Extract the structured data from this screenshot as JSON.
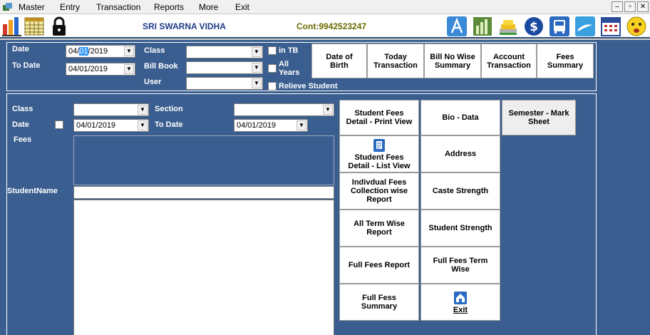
{
  "menu": {
    "items": [
      "Master",
      "Entry",
      "Transaction",
      "Reports",
      "More",
      "Exit"
    ]
  },
  "window_controls": {
    "minimize": "–",
    "restore": "▫",
    "close": "✕"
  },
  "header": {
    "school_name": "SRI SWARNA VIDHA",
    "contact": "Cont:9942523247"
  },
  "toolbar_icons": [
    "bar-chart-icon",
    "calendar-grid-icon",
    "lock-icon",
    "app-a-icon",
    "chart-report-icon",
    "cash-stack-icon",
    "dollar-icon",
    "bus-icon",
    "mail-icon",
    "calendar-icon",
    "smiley-icon"
  ],
  "top_filter": {
    "date_label": "Date",
    "date_value_pre": "04/",
    "date_value_sel": "01",
    "date_value_post": "/2019",
    "to_date_label": "To Date",
    "to_date_value": "04/01/2019",
    "class_label": "Class",
    "class_value": "",
    "bill_book_label": "Bill Book",
    "bill_book_value": "",
    "user_label": "User",
    "user_value": "",
    "in_tb_label": "in TB",
    "all_years_label_1": "All",
    "all_years_label_2": "Years",
    "relieve_label": "Relieve Student"
  },
  "top_buttons": [
    [
      "Date of",
      "Birth"
    ],
    [
      "Today",
      "Transaction"
    ],
    [
      "Bill No Wise",
      "Summary"
    ],
    [
      "Account",
      "Transaction"
    ],
    [
      "Fees",
      "Summary"
    ]
  ],
  "bottom_filter": {
    "class_label": "Class",
    "class_value": "",
    "section_label": "Section",
    "section_value": "",
    "date_label": "Date",
    "date_value": "04/01/2019",
    "to_date_label": "To Date",
    "to_date_value": "04/01/2019",
    "fees_label": "Fees",
    "student_name_label": "StudentName",
    "student_name_value": ""
  },
  "report_buttons": {
    "student_fees_print": [
      "Student Fees",
      "Detail - Print View"
    ],
    "bio_data": [
      "Bio - Data"
    ],
    "semester_mark": [
      "Semester - Mark",
      "Sheet"
    ],
    "student_fees_list": [
      "Student Fees",
      "Detail - List View"
    ],
    "address": [
      "Address"
    ],
    "individual_fees": [
      "Indivdual Fees",
      "Collection wise",
      "Report"
    ],
    "caste_strength": [
      "Caste Strength"
    ],
    "all_term": [
      "All Term Wise",
      "Report"
    ],
    "student_strength": [
      "Student Strength"
    ],
    "full_fees_report": [
      "Full Fees Report"
    ],
    "full_fees_term": [
      "Full Fees Term",
      "Wise"
    ],
    "full_fess_summary": [
      "Full Fess",
      "Summary"
    ],
    "exit": [
      "Exit"
    ]
  },
  "colors": {
    "background_blue": "#3a5e8f",
    "header_text_blue": "#1f3c88",
    "contact_text": "#6a6a00",
    "selection": "#3399ff"
  }
}
